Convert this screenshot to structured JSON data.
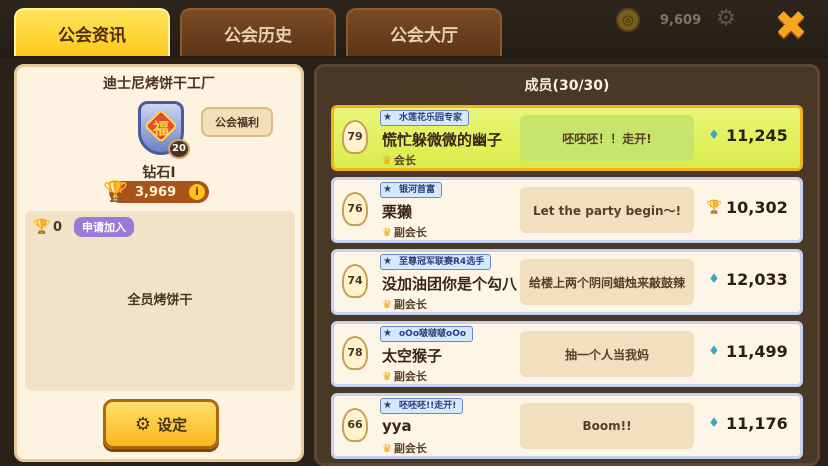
{
  "tabs": [
    {
      "label": "公会资讯",
      "active": true
    },
    {
      "label": "公会历史",
      "active": false
    },
    {
      "label": "公会大厅",
      "active": false
    }
  ],
  "topbar": {
    "currency_value": "9,609",
    "close_symbol": "✖"
  },
  "guild": {
    "name": "迪士尼烤饼干工厂",
    "emblem_char": "福",
    "level": "20",
    "benefits_label": "公会福利",
    "rank": "钻石Ⅰ",
    "trophies": "3,969",
    "info_symbol": "i",
    "join_requirement": "0",
    "apply_label": "申请加入",
    "description": "全员烤饼干",
    "settings_label": "设定"
  },
  "members_panel": {
    "title": "成员(30/30)",
    "members": [
      {
        "level": "79",
        "title": "水莲花乐园专家",
        "name": "慌忙躲微微的幽子",
        "role": "会长",
        "message": "呸呸呸！！走开!",
        "score": "11,245",
        "score_icon": "gem",
        "self": true
      },
      {
        "level": "76",
        "title": "银河首富",
        "name": "栗獭",
        "role": "副会长",
        "message": "Let the party begin～!",
        "score": "10,302",
        "score_icon": "trophy",
        "self": false
      },
      {
        "level": "74",
        "title": "至尊冠军联赛R4选手",
        "name": "没加油团你是个勾八",
        "role": "副会长",
        "message": "给楼上两个阴间蜡烛来敲鼓辣",
        "score": "12,033",
        "score_icon": "gem",
        "self": false
      },
      {
        "level": "78",
        "title": "oOo啵啵啵oOo",
        "name": "太空猴子",
        "role": "副会长",
        "message": "抽一个人当我妈",
        "score": "11,499",
        "score_icon": "gem",
        "self": false
      },
      {
        "level": "66",
        "title": "呸呸呸!!走开!",
        "name": "yya",
        "role": "副会长",
        "message": "Boom!!",
        "score": "11,176",
        "score_icon": "gem",
        "self": false
      }
    ]
  },
  "colors": {
    "active_tab": "#ffc81e",
    "self_row": "#d9ec4a",
    "panel_bg": "#4a3826"
  }
}
